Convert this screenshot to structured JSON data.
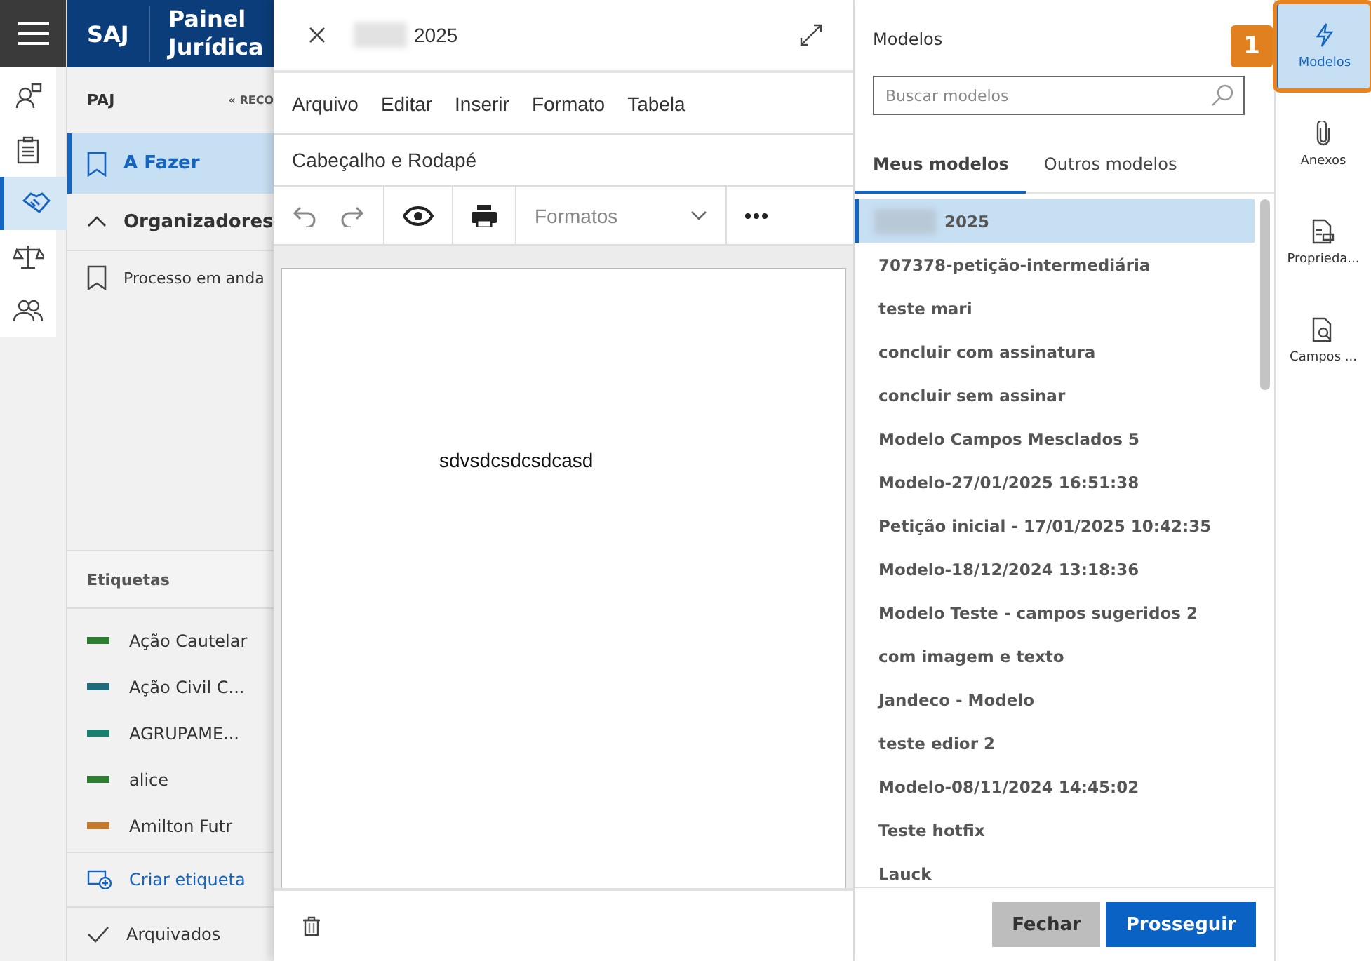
{
  "nav_rail": [
    {
      "kind": "user",
      "selected": false
    },
    {
      "kind": "clipboard",
      "selected": false
    },
    {
      "kind": "handshake",
      "selected": true
    },
    {
      "kind": "scales",
      "selected": false
    },
    {
      "kind": "group",
      "selected": false
    }
  ],
  "header": {
    "logo": "SAJ",
    "title_lines": [
      "Painel",
      "Jurídica"
    ]
  },
  "left_panel": {
    "title": "PAJ",
    "collapse_label": "« RECO",
    "items": [
      {
        "label": "A Fazer",
        "selected": true
      }
    ],
    "group": {
      "label": "Organizadores",
      "expanded": true,
      "children": [
        {
          "label": "Processo em anda"
        }
      ]
    },
    "tags_title": "Etiquetas",
    "tags": [
      {
        "label": "Ação Cautelar",
        "color": "#2e7d32"
      },
      {
        "label": "Ação Civil C...",
        "color": "#1f6b7a"
      },
      {
        "label": "AGRUPAME...",
        "color": "#1a7f6e"
      },
      {
        "label": "alice",
        "color": "#2e7d32"
      },
      {
        "label": "Amilton Futr",
        "color": "#c47a2c"
      }
    ],
    "create_tag": "Criar etiqueta",
    "archived": "Arquivados"
  },
  "editor": {
    "title": "2025",
    "title_redacted": true,
    "menu": [
      "Arquivo",
      "Editar",
      "Inserir",
      "Formato",
      "Tabela"
    ],
    "header_footer": "Cabeçalho e Rodapé",
    "format_select": {
      "placeholder": "Formatos"
    },
    "body_text": "sdvsdcsdcsdcasd"
  },
  "models_panel": {
    "title": "Modelos",
    "search": {
      "placeholder": "Buscar modelos"
    },
    "tabs": [
      {
        "label": "Meus modelos",
        "selected": true
      },
      {
        "label": "Outros modelos",
        "selected": false
      }
    ],
    "items": [
      {
        "label": "2025",
        "selected": true,
        "redacted": true
      },
      {
        "label": "707378-petição-intermediária",
        "selected": false,
        "redacted": false
      },
      {
        "label": "teste mari",
        "selected": false,
        "redacted": false
      },
      {
        "label": "concluir com assinatura",
        "selected": false,
        "redacted": false
      },
      {
        "label": "concluir sem assinar",
        "selected": false,
        "redacted": false
      },
      {
        "label": "Modelo Campos Mesclados 5",
        "selected": false,
        "redacted": false
      },
      {
        "label": "Modelo-27/01/2025 16:51:38",
        "selected": false,
        "redacted": false
      },
      {
        "label": "Petição inicial - 17/01/2025 10:42:35",
        "selected": false,
        "redacted": false
      },
      {
        "label": "Modelo-18/12/2024 13:18:36",
        "selected": false,
        "redacted": false
      },
      {
        "label": "Modelo Teste - campos sugeridos 2",
        "selected": false,
        "redacted": false
      },
      {
        "label": "com imagem e texto",
        "selected": false,
        "redacted": false
      },
      {
        "label": "Jandeco - Modelo",
        "selected": false,
        "redacted": false
      },
      {
        "label": "teste edior 2",
        "selected": false,
        "redacted": false
      },
      {
        "label": "Modelo-08/11/2024 14:45:02",
        "selected": false,
        "redacted": false
      },
      {
        "label": "Teste hotfix",
        "selected": false,
        "redacted": false
      },
      {
        "label": "Lauck",
        "selected": false,
        "redacted": false
      }
    ],
    "buttons": [
      {
        "label": "Fechar",
        "kind": "secondary"
      },
      {
        "label": "Prosseguir",
        "kind": "primary"
      }
    ]
  },
  "right_rail": [
    {
      "label": "Modelos",
      "kind": "bolt",
      "selected": true,
      "highlighted": true
    },
    {
      "label": "Anexos",
      "kind": "clip",
      "selected": false,
      "highlighted": false
    },
    {
      "label": "Proprieda...",
      "kind": "doc-list",
      "selected": false,
      "highlighted": false
    },
    {
      "label": "Campos ...",
      "kind": "doc-search",
      "selected": false,
      "highlighted": false
    }
  ],
  "callout": {
    "label": "1"
  }
}
